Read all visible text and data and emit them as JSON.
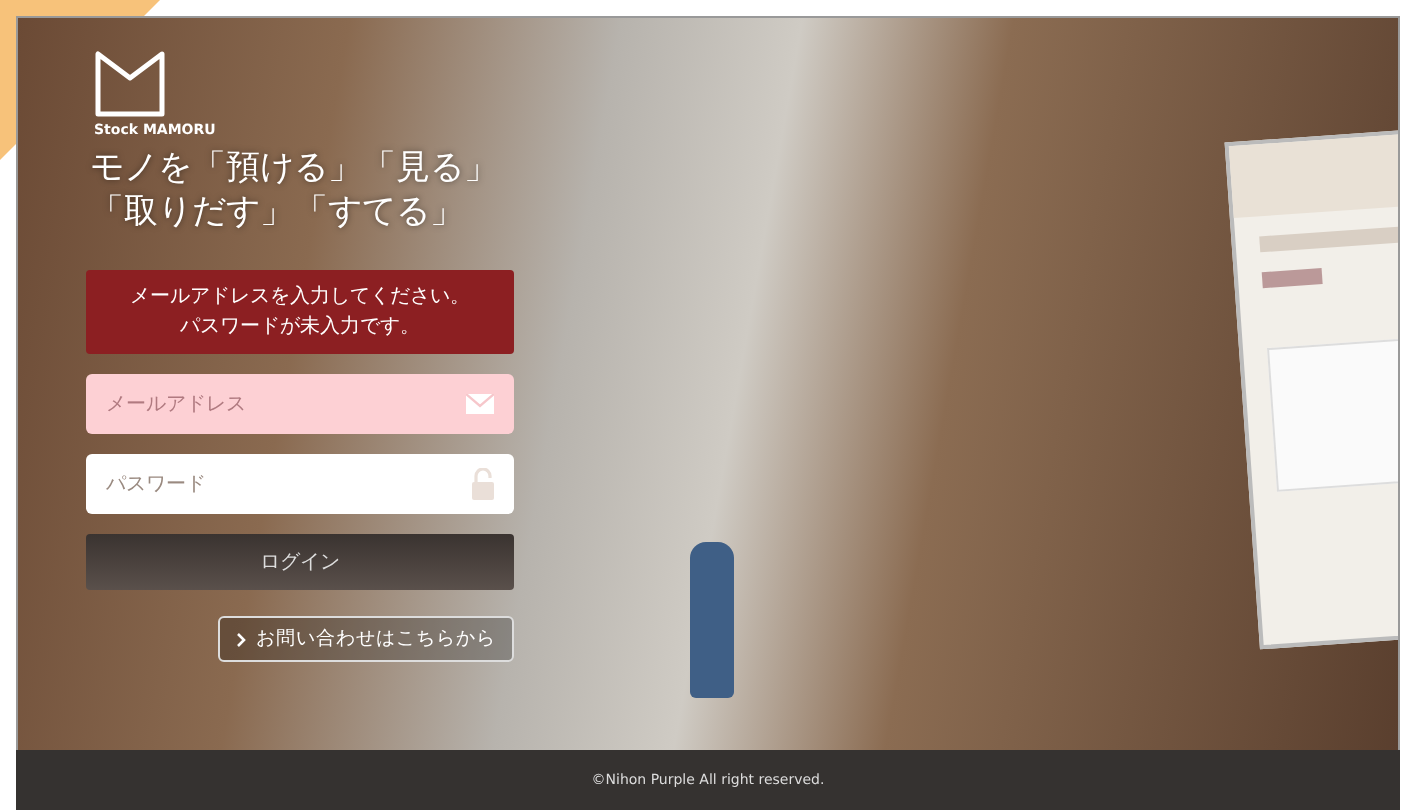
{
  "brand": {
    "name": "Stock MAMORU"
  },
  "tagline": [
    "モノを「預ける」「見る」",
    "「取りだす」「すてる」"
  ],
  "error_message": [
    "メールアドレスを入力してください。",
    "パスワードが未入力です。"
  ],
  "fields": [
    {
      "kind": "email",
      "placeholder": "メールアドレス",
      "invalid": true
    },
    {
      "kind": "password",
      "placeholder": "パスワード",
      "invalid": false
    }
  ],
  "login_button": "ログイン",
  "contact_link": "お問い合わせはこちらから",
  "footer": "©Nihon Purple All right reserved."
}
